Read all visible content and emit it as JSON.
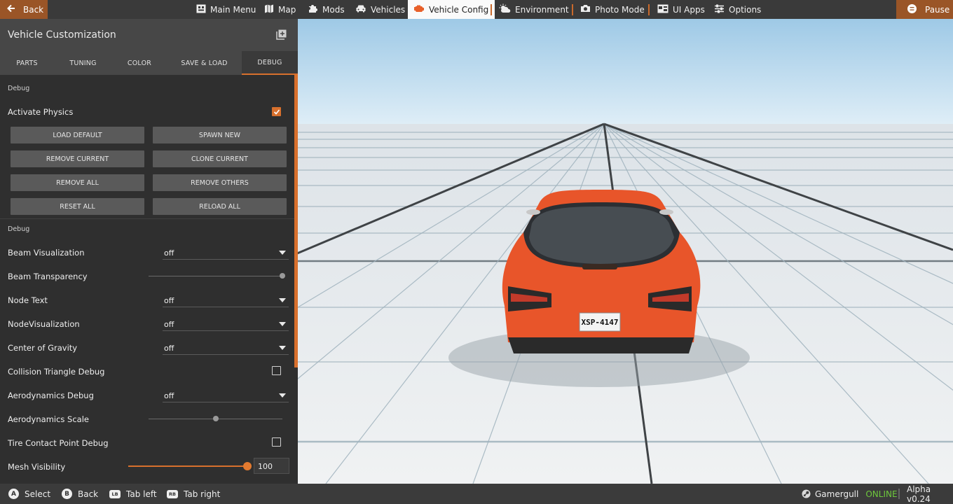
{
  "topbar": {
    "back_label": "Back",
    "pause_label": "Pause",
    "menu": [
      {
        "label": "Main Menu",
        "icon": "main-menu-icon"
      },
      {
        "label": "Map",
        "icon": "map-icon"
      },
      {
        "label": "Mods",
        "icon": "puzzle-icon"
      },
      {
        "label": "Vehicles",
        "icon": "car-icon"
      },
      {
        "label": "Vehicle Config",
        "icon": "engine-icon",
        "active": true
      },
      {
        "label": "Environment",
        "icon": "weather-icon"
      },
      {
        "label": "Photo Mode",
        "icon": "camera-icon"
      },
      {
        "label": "UI Apps",
        "icon": "ui-apps-icon"
      },
      {
        "label": "Options",
        "icon": "sliders-icon"
      }
    ]
  },
  "panel": {
    "title": "Vehicle Customization",
    "tabs": [
      "PARTS",
      "TUNING",
      "COLOR",
      "SAVE & LOAD",
      "DEBUG"
    ],
    "active_tab": "DEBUG",
    "section1_label": "Debug",
    "activate_physics_label": "Activate Physics",
    "activate_physics_checked": true,
    "buttons": {
      "load_default": "LOAD DEFAULT",
      "spawn_new": "SPAWN NEW",
      "remove_current": "REMOVE CURRENT",
      "clone_current": "CLONE CURRENT",
      "remove_all": "REMOVE ALL",
      "remove_others": "REMOVE OTHERS",
      "reset_all": "RESET ALL",
      "reload_all": "RELOAD ALL"
    },
    "section2_label": "Debug",
    "settings": {
      "beam_visualization": {
        "label": "Beam Visualization",
        "value": "off"
      },
      "beam_transparency": {
        "label": "Beam Transparency",
        "level": 1.0
      },
      "node_text": {
        "label": "Node Text",
        "value": "off"
      },
      "node_visualization": {
        "label": "NodeVisualization",
        "value": "off"
      },
      "center_of_gravity": {
        "label": "Center of Gravity",
        "value": "off"
      },
      "collision_triangle_debug": {
        "label": "Collision Triangle Debug",
        "checked": false
      },
      "aerodynamics_debug": {
        "label": "Aerodynamics Debug",
        "value": "off"
      },
      "aerodynamics_scale": {
        "label": "Aerodynamics Scale",
        "level": 0.5
      },
      "tire_contact_point_debug": {
        "label": "Tire Contact Point Debug",
        "checked": false
      },
      "mesh_visibility": {
        "label": "Mesh Visibility",
        "value": "100"
      }
    }
  },
  "viewport": {
    "license_plate": "XSP-4147",
    "car_color": "#e8552a"
  },
  "bottombar": {
    "hints": [
      {
        "button": "A",
        "label": "Select"
      },
      {
        "button": "B",
        "label": "Back"
      },
      {
        "button": "LB",
        "label": "Tab left"
      },
      {
        "button": "RB",
        "label": "Tab right"
      }
    ],
    "username": "Gamergull",
    "status": "ONLINE",
    "version": "Alpha v0.24"
  },
  "colors": {
    "accent": "#d8702d",
    "topbar_orange": "#9a5527",
    "online": "#6ec93c"
  }
}
